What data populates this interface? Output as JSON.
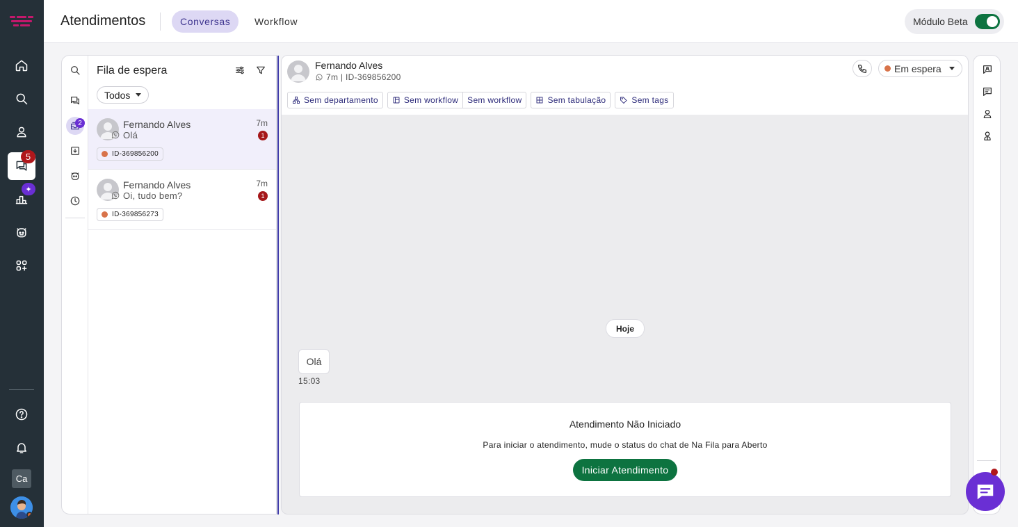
{
  "app": {
    "title": "Atendimentos",
    "tabs": [
      {
        "label": "Conversas",
        "active": true
      },
      {
        "label": "Workflow",
        "active": false
      }
    ],
    "beta_label": "Módulo Beta",
    "beta_enabled": true
  },
  "rail": {
    "items": [
      "home-icon",
      "search-icon",
      "user-icon",
      "chat-icon",
      "chart-icon",
      "bot-icon",
      "apps-icon"
    ],
    "active": "chat-icon",
    "chat_badge": "5",
    "spark": "✦",
    "bottom": [
      "help-icon",
      "bell-icon"
    ],
    "user_initials": "Ca",
    "colors": {
      "background": "#253038",
      "badge": "#b0171b",
      "accent": "#6a2fd4"
    }
  },
  "queue": {
    "title": "Fila de espera",
    "filter_label": "Todos",
    "rail_badge": "2",
    "items": [
      {
        "name": "Fernando Alves",
        "message": "Olá",
        "time": "7m",
        "count": "1",
        "id": "ID-369856200",
        "selected": true
      },
      {
        "name": "Fernando Alves",
        "message": "Oi, tudo bem?",
        "time": "7m",
        "count": "1",
        "id": "ID-369856273",
        "selected": false
      }
    ]
  },
  "chat": {
    "contact_name": "Fernando Alves",
    "subtitle": "7m | ID-369856200",
    "status": "Em espera",
    "chips": {
      "department": "Sem departamento",
      "workflow_a": "Sem workflow",
      "workflow_b": "Sem workflow",
      "tabulation": "Sem tabulação",
      "tags": "Sem tags"
    },
    "date_divider": "Hoje",
    "message": {
      "text": "Olá",
      "time": "15:03"
    },
    "notice": {
      "title": "Atendimento Não Iniciado",
      "description": "Para iniciar o atendimento, mude o status do chat de Na Fila para Aberto",
      "button": "Iniciar Atendimento"
    },
    "colors": {
      "primary_green": "#0d7340",
      "status_dot": "#d8734a",
      "accent_purple": "#6a2fd4"
    }
  }
}
